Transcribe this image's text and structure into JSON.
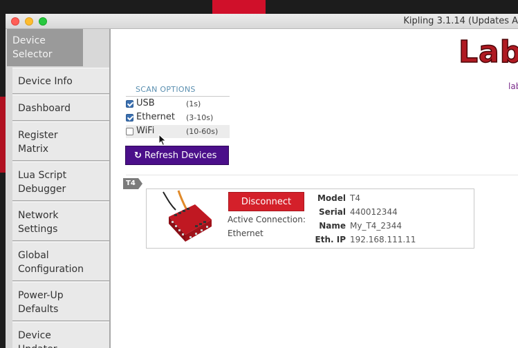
{
  "window": {
    "title": "Kipling 3.1.14 (Updates A"
  },
  "logo": {
    "text": "Lab",
    "sub": "lab"
  },
  "sidebar": {
    "active": {
      "label": "Device Selector"
    },
    "items": [
      {
        "label": "Device Info"
      },
      {
        "label": "Dashboard"
      },
      {
        "label": "Register Matrix"
      },
      {
        "label": "Lua Script Debugger"
      },
      {
        "label": "Network Settings"
      },
      {
        "label": "Global Configuration"
      },
      {
        "label": "Power-Up Defaults"
      },
      {
        "label": "Device Updater"
      }
    ]
  },
  "scan": {
    "title": "SCAN OPTIONS",
    "options": [
      {
        "name": "USB",
        "time": "(1s)",
        "checked": true
      },
      {
        "name": "Ethernet",
        "time": "(3-10s)",
        "checked": true
      },
      {
        "name": "WiFi",
        "time": "(10-60s)",
        "checked": false
      }
    ],
    "refresh_label": "Refresh Devices"
  },
  "device_group": {
    "tag": "T4"
  },
  "device": {
    "disconnect_label": "Disconnect",
    "active_connection_label": "Active Connection:",
    "active_connection_value": "Ethernet",
    "details": [
      {
        "key": "Model",
        "value": "T4"
      },
      {
        "key": "Serial",
        "value": "440012344"
      },
      {
        "key": "Name",
        "value": "My_T4_2344"
      },
      {
        "key": "Eth. IP",
        "value": "192.168.111.11"
      }
    ]
  },
  "colors": {
    "accent_purple": "#4b0f8a",
    "disconnect_red": "#d4202a",
    "brand_red": "#b01a22"
  }
}
